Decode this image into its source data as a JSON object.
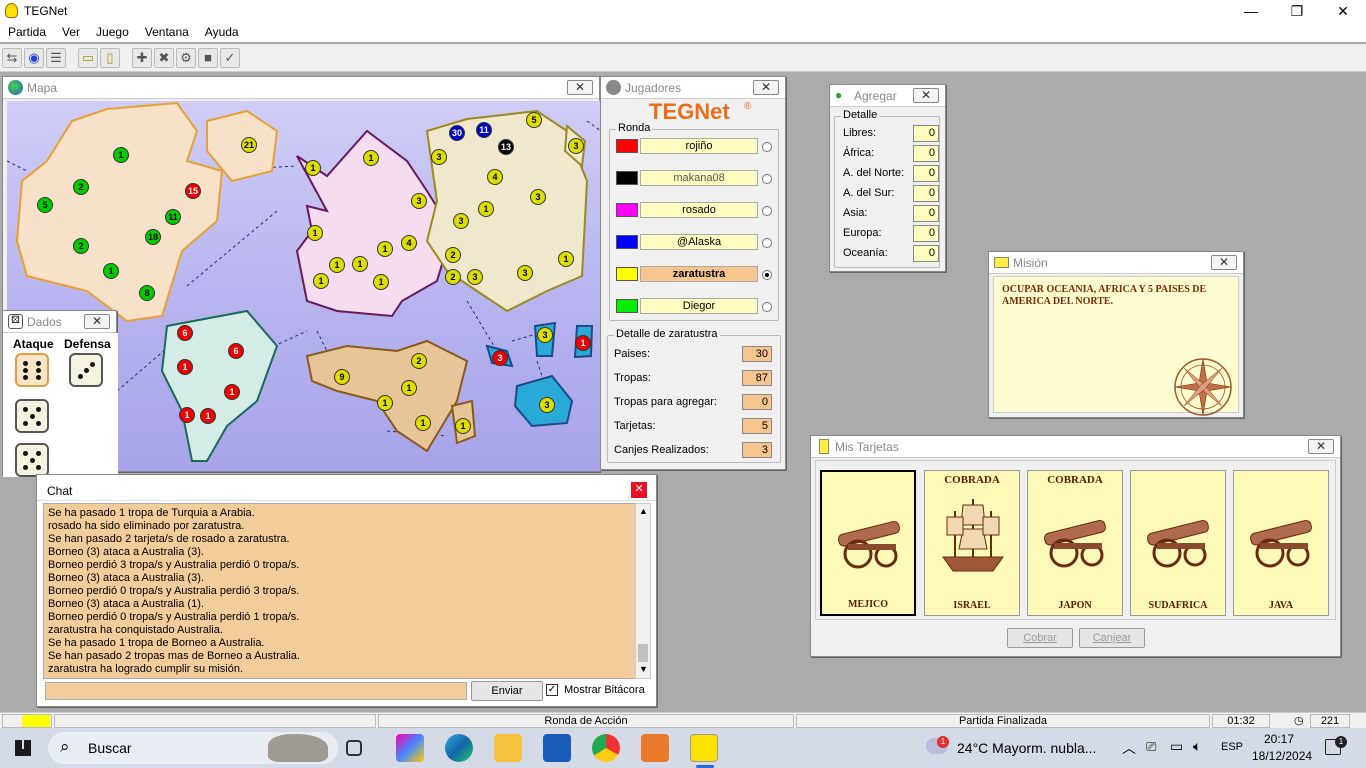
{
  "app": {
    "title": "TEGNet"
  },
  "menu": [
    "Partida",
    "Ver",
    "Juego",
    "Ventana",
    "Ayuda"
  ],
  "windows": {
    "map": {
      "title": "Mapa"
    },
    "dados": {
      "title": "Dados",
      "ataque": "Ataque",
      "defensa": "Defensa"
    },
    "jugadores": {
      "title": "Jugadores",
      "logo": "TEGNet",
      "ronda_label": "Ronda",
      "players": [
        {
          "name": "rojiño",
          "color": "#ff0000",
          "active": false
        },
        {
          "name": "makana08",
          "color": "#000000",
          "active": false
        },
        {
          "name": "rosado",
          "color": "#ff00ff",
          "active": false
        },
        {
          "name": "@Alaska",
          "color": "#0000ff",
          "active": false
        },
        {
          "name": "zaratustra",
          "color": "#ffff00",
          "active": true
        },
        {
          "name": "Diegor",
          "color": "#00ee00",
          "active": false
        }
      ],
      "detalle_label": "Detalle de zaratustra",
      "detalle": [
        {
          "label": "Paises:",
          "value": "30"
        },
        {
          "label": "Tropas:",
          "value": "87"
        },
        {
          "label": "Tropas para agregar:",
          "value": "0"
        },
        {
          "label": "Tarjetas:",
          "value": "5"
        },
        {
          "label": "Canjes Realizados:",
          "value": "3"
        }
      ]
    },
    "agregar": {
      "title": "Agregar",
      "detalle_label": "Detalle",
      "rows": [
        {
          "label": "Libres:",
          "value": "0"
        },
        {
          "label": "África:",
          "value": "0"
        },
        {
          "label": "A. del Norte:",
          "value": "0"
        },
        {
          "label": "A. del Sur:",
          "value": "0"
        },
        {
          "label": "Asia:",
          "value": "0"
        },
        {
          "label": "Europa:",
          "value": "0"
        },
        {
          "label": "Oceanía:",
          "value": "0"
        }
      ]
    },
    "mision": {
      "title": "Misión",
      "text": "OCUPAR OCEANIA, AFRICA Y 5 PAISES DE AMERICA DEL NORTE."
    },
    "tarjetas": {
      "title": "Mis Tarjetas",
      "cards": [
        {
          "country": "MEJICO",
          "status": "",
          "symbol": "cannon",
          "selected": true
        },
        {
          "country": "ISRAEL",
          "status": "COBRADA",
          "symbol": "ship",
          "selected": false
        },
        {
          "country": "JAPON",
          "status": "COBRADA",
          "symbol": "cannon",
          "selected": false
        },
        {
          "country": "SUDAFRICA",
          "status": "",
          "symbol": "cannon",
          "selected": false
        },
        {
          "country": "JAVA",
          "status": "",
          "symbol": "cannon",
          "selected": false
        }
      ],
      "cobrar": "Cobrar",
      "canjear": "Canjear"
    },
    "chat": {
      "title": "Chat",
      "lines": [
        "Se ha pasado 1 tropa de Turquia a Arabia.",
        "rosado ha sido eliminado por zaratustra.",
        "Se han pasado 2 tarjeta/s de rosado a zaratustra.",
        "Borneo (3) ataca a Australia (3).",
        "Borneo perdió 3 tropa/s y Australia perdió 0 tropa/s.",
        "Borneo (3) ataca a Australia (3).",
        "Borneo perdió 0 tropa/s y Australia perdió 3 tropa/s.",
        "Borneo (3) ataca a Australia (1).",
        "Borneo perdió 0 tropa/s y Australia perdió 1 tropa/s.",
        "zaratustra ha conquistado Australia.",
        "Se ha pasado 1 tropa de Borneo a Australia.",
        "Se han pasado 2 tropas mas de Borneo a Australia.",
        "zaratustra ha logrado cumplir su misión."
      ],
      "send": "Enviar",
      "bitacora": "Mostrar Bitácora"
    }
  },
  "map_armies": [
    {
      "n": "1",
      "c": "#00cc00"
    },
    {
      "n": "2",
      "c": "#00cc00"
    },
    {
      "n": "5",
      "c": "#00cc00"
    },
    {
      "n": "2",
      "c": "#00cc00"
    },
    {
      "n": "1",
      "c": "#00cc00"
    },
    {
      "n": "8",
      "c": "#00cc00"
    },
    {
      "n": "18",
      "c": "#00cc00"
    },
    {
      "n": "11",
      "c": "#00cc00"
    },
    {
      "n": "15",
      "c": "#ee0000"
    },
    {
      "n": "21",
      "c": "#dddd00"
    },
    {
      "n": "1",
      "c": "#dddd00"
    },
    {
      "n": "1",
      "c": "#dddd00"
    },
    {
      "n": "1",
      "c": "#dddd00"
    },
    {
      "n": "3",
      "c": "#dddd00"
    },
    {
      "n": "1",
      "c": "#dddd00"
    },
    {
      "n": "1",
      "c": "#dddd00"
    },
    {
      "n": "1",
      "c": "#dddd00"
    },
    {
      "n": "4",
      "c": "#dddd00"
    },
    {
      "n": "1",
      "c": "#dddd00"
    },
    {
      "n": "3",
      "c": "#dddd00"
    },
    {
      "n": "2",
      "c": "#dddd00"
    },
    {
      "n": "2",
      "c": "#dddd00"
    },
    {
      "n": "1",
      "c": "#dddd00"
    },
    {
      "n": "30",
      "c": "#0000cc"
    },
    {
      "n": "11",
      "c": "#0000cc"
    },
    {
      "n": "13",
      "c": "#000000"
    },
    {
      "n": "5",
      "c": "#dddd00"
    },
    {
      "n": "3",
      "c": "#dddd00"
    },
    {
      "n": "3",
      "c": "#dddd00"
    },
    {
      "n": "4",
      "c": "#dddd00"
    },
    {
      "n": "1",
      "c": "#dddd00"
    },
    {
      "n": "3",
      "c": "#dddd00"
    },
    {
      "n": "3",
      "c": "#dddd00"
    },
    {
      "n": "3",
      "c": "#dddd00"
    },
    {
      "n": "1",
      "c": "#dddd00"
    },
    {
      "n": "6",
      "c": "#ee0000"
    },
    {
      "n": "6",
      "c": "#ee0000"
    },
    {
      "n": "1",
      "c": "#ee0000"
    },
    {
      "n": "1",
      "c": "#ee0000"
    },
    {
      "n": "1",
      "c": "#ee0000"
    },
    {
      "n": "1",
      "c": "#ee0000"
    },
    {
      "n": "2",
      "c": "#dddd00"
    },
    {
      "n": "9",
      "c": "#dddd00"
    },
    {
      "n": "1",
      "c": "#dddd00"
    },
    {
      "n": "1",
      "c": "#dddd00"
    },
    {
      "n": "1",
      "c": "#dddd00"
    },
    {
      "n": "1",
      "c": "#dddd00"
    },
    {
      "n": "3",
      "c": "#ee0000"
    },
    {
      "n": "3",
      "c": "#dddd00"
    },
    {
      "n": "1",
      "c": "#ee0000"
    },
    {
      "n": "3",
      "c": "#dddd00"
    }
  ],
  "statusbar": {
    "ronda": "Ronda de Acción",
    "partida": "Partida Finalizada",
    "time": "01:32",
    "count": "221"
  },
  "taskbar": {
    "search": "Buscar",
    "weather": "24°C  Mayorm. nubla...",
    "lang": "ESP",
    "clock_time": "20:17",
    "clock_date": "18/12/2024",
    "notif": "1"
  }
}
